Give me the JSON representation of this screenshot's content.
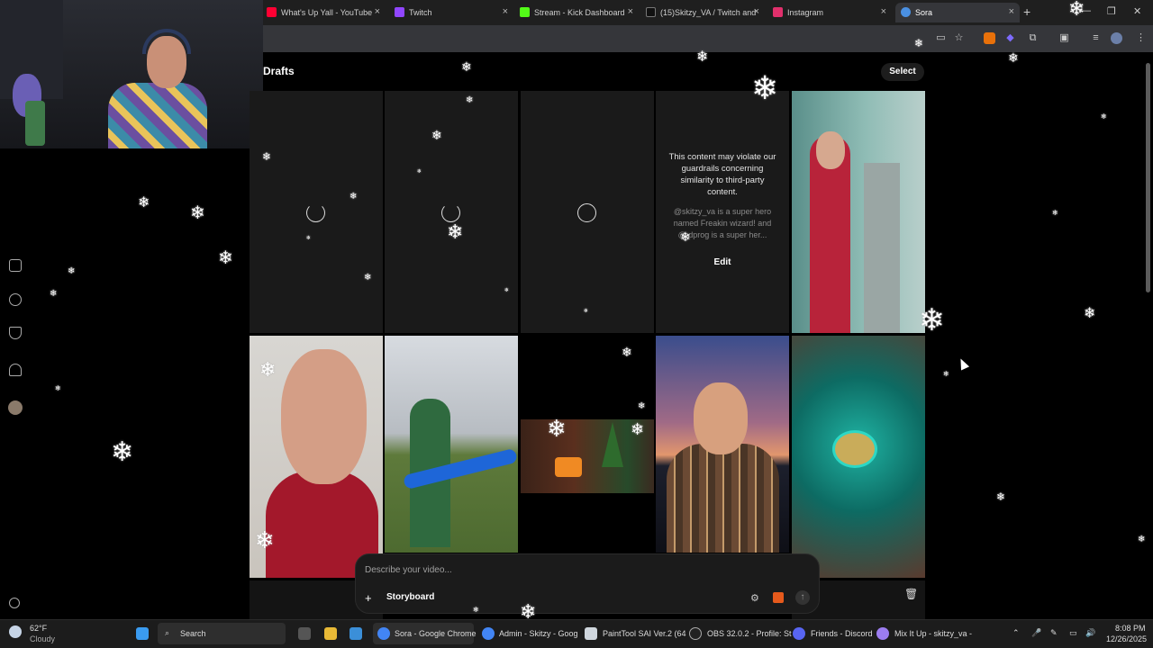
{
  "browser": {
    "tabs": [
      {
        "label": "What's Up Yall - YouTube",
        "color": "#ff0033"
      },
      {
        "label": "Twitch",
        "color": "#9146ff"
      },
      {
        "label": "Stream - Kick Dashboard",
        "color": "#53fc18"
      },
      {
        "label": "(15)Skitzy_VA / Twitch and",
        "color": "#111111"
      },
      {
        "label": "Instagram",
        "color": "#e1306c"
      },
      {
        "label": "Sora",
        "color": "#4a90e2"
      }
    ],
    "new_tab": "+"
  },
  "page": {
    "title": "Drafts",
    "select_label": "Select"
  },
  "guardrail": {
    "message": "This content may violate our guardrails concerning similarity to third-party content.",
    "prompt": "@skitzy_va is a super hero named Freakin wizard! and @         dprog is a super her...",
    "edit_label": "Edit"
  },
  "composer": {
    "placeholder": "Describe your video...",
    "storyboard_label": "Storyboard"
  },
  "taskbar": {
    "weather_temp": "62°F",
    "weather_cond": "Cloudy",
    "search_label": "Search",
    "apps": [
      {
        "label": "Sora - Google Chrome"
      },
      {
        "label": "Admin - Skitzy - Goog"
      },
      {
        "label": "PaintTool SAI Ver.2 (64"
      },
      {
        "label": "OBS 32.0.2 - Profile: St"
      },
      {
        "label": "Friends - Discord"
      },
      {
        "label": "Mix It Up - skitzy_va - "
      }
    ],
    "time": "8:08 PM",
    "date": "12/26/2025"
  },
  "colors": {
    "accent_sora": "#4a90e2",
    "gift_icon": "#e65a1c"
  }
}
